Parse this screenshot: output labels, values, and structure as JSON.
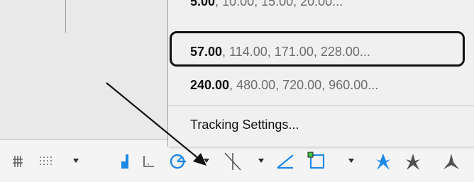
{
  "menu": {
    "items": [
      {
        "primary": "5.00",
        "rest": ", 10.00, 15.00, 20.00..."
      },
      {
        "primary": "57.00",
        "rest": ", 114.00, 171.00, 228.00..."
      },
      {
        "primary": "240.00",
        "rest": ", 480.00, 720.00, 960.00..."
      }
    ],
    "tracking_settings": "Tracking Settings..."
  },
  "toolbar": {
    "icons": [
      "grid-snap-icon",
      "grid-display-icon",
      "dropdown-icon",
      "snap-mode-icon",
      "ortho-icon",
      "polar-tracking-icon",
      "dropdown-icon",
      "isodraft-icon",
      "dropdown-icon",
      "object-snap-tracking-icon",
      "object-snap-icon",
      "dropdown-icon",
      "annotation-visibility-icon",
      "annotation-scale-icon",
      "annotation-autoscale-icon"
    ],
    "accent_color": "#1e88e5"
  }
}
